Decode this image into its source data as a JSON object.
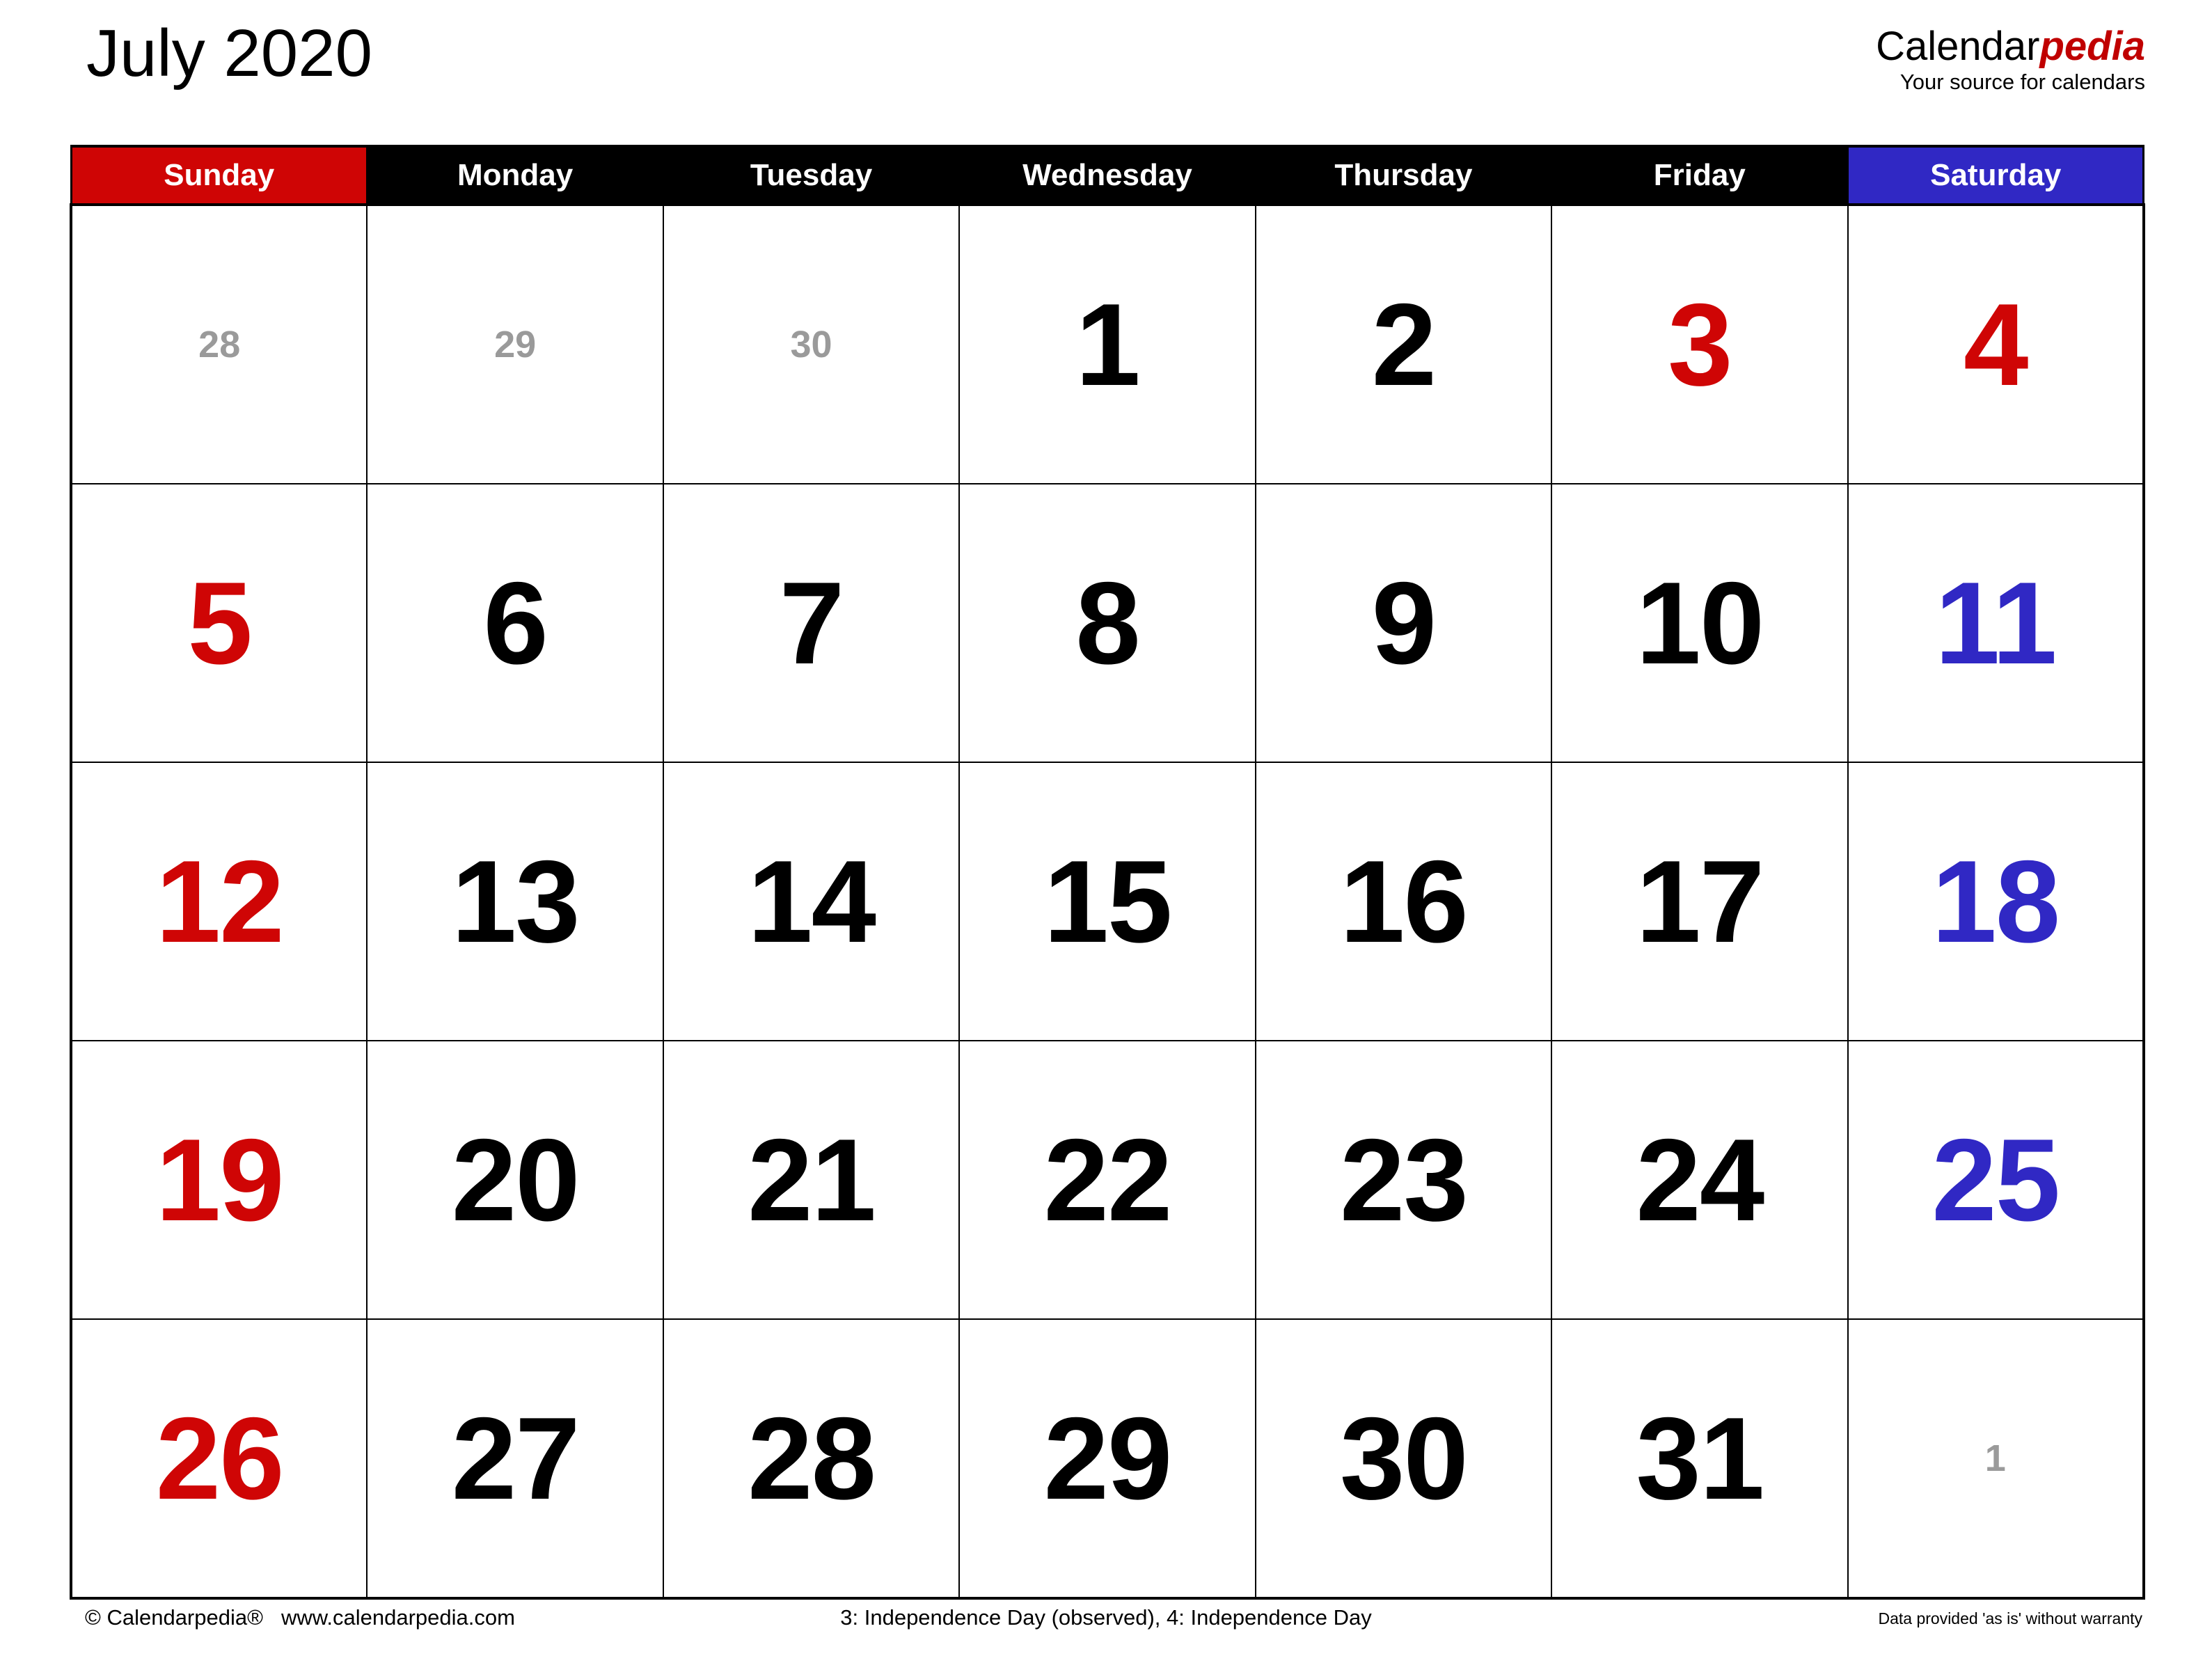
{
  "header": {
    "month_title": "July 2020",
    "brand_name_part1": "Calendar",
    "brand_name_part2": "pedia",
    "brand_tagline": "Your source for calendars"
  },
  "colors": {
    "sunday_header_bg": "#cf0505",
    "saturday_header_bg": "#3028c4",
    "weekday_header_bg": "#000000",
    "sunday_text": "#cf0505",
    "saturday_text": "#3028c4",
    "weekday_text": "#000000",
    "adjacent_month_text": "#9a9a9a",
    "brand_accent": "#c00000"
  },
  "weekday_headers": [
    {
      "label": "Sunday",
      "style": "sunday"
    },
    {
      "label": "Monday",
      "style": "weekday"
    },
    {
      "label": "Tuesday",
      "style": "weekday"
    },
    {
      "label": "Wednesday",
      "style": "weekday"
    },
    {
      "label": "Thursday",
      "style": "weekday"
    },
    {
      "label": "Friday",
      "style": "weekday"
    },
    {
      "label": "Saturday",
      "style": "saturday"
    }
  ],
  "weeks": [
    [
      {
        "day": "28",
        "kind": "adjacent"
      },
      {
        "day": "29",
        "kind": "adjacent"
      },
      {
        "day": "30",
        "kind": "adjacent"
      },
      {
        "day": "1",
        "kind": "weekday"
      },
      {
        "day": "2",
        "kind": "weekday"
      },
      {
        "day": "3",
        "kind": "holiday"
      },
      {
        "day": "4",
        "kind": "holiday"
      }
    ],
    [
      {
        "day": "5",
        "kind": "sunday"
      },
      {
        "day": "6",
        "kind": "weekday"
      },
      {
        "day": "7",
        "kind": "weekday"
      },
      {
        "day": "8",
        "kind": "weekday"
      },
      {
        "day": "9",
        "kind": "weekday"
      },
      {
        "day": "10",
        "kind": "weekday"
      },
      {
        "day": "11",
        "kind": "saturday"
      }
    ],
    [
      {
        "day": "12",
        "kind": "sunday"
      },
      {
        "day": "13",
        "kind": "weekday"
      },
      {
        "day": "14",
        "kind": "weekday"
      },
      {
        "day": "15",
        "kind": "weekday"
      },
      {
        "day": "16",
        "kind": "weekday"
      },
      {
        "day": "17",
        "kind": "weekday"
      },
      {
        "day": "18",
        "kind": "saturday"
      }
    ],
    [
      {
        "day": "19",
        "kind": "sunday"
      },
      {
        "day": "20",
        "kind": "weekday"
      },
      {
        "day": "21",
        "kind": "weekday"
      },
      {
        "day": "22",
        "kind": "weekday"
      },
      {
        "day": "23",
        "kind": "weekday"
      },
      {
        "day": "24",
        "kind": "weekday"
      },
      {
        "day": "25",
        "kind": "saturday"
      }
    ],
    [
      {
        "day": "26",
        "kind": "sunday"
      },
      {
        "day": "27",
        "kind": "weekday"
      },
      {
        "day": "28",
        "kind": "weekday"
      },
      {
        "day": "29",
        "kind": "weekday"
      },
      {
        "day": "30",
        "kind": "weekday"
      },
      {
        "day": "31",
        "kind": "weekday"
      },
      {
        "day": "1",
        "kind": "adjacent"
      }
    ]
  ],
  "footer": {
    "copyright": "© Calendarpedia®",
    "website": "www.calendarpedia.com",
    "holidays_note": "3: Independence Day (observed), 4: Independence Day",
    "disclaimer": "Data provided 'as is' without warranty"
  }
}
